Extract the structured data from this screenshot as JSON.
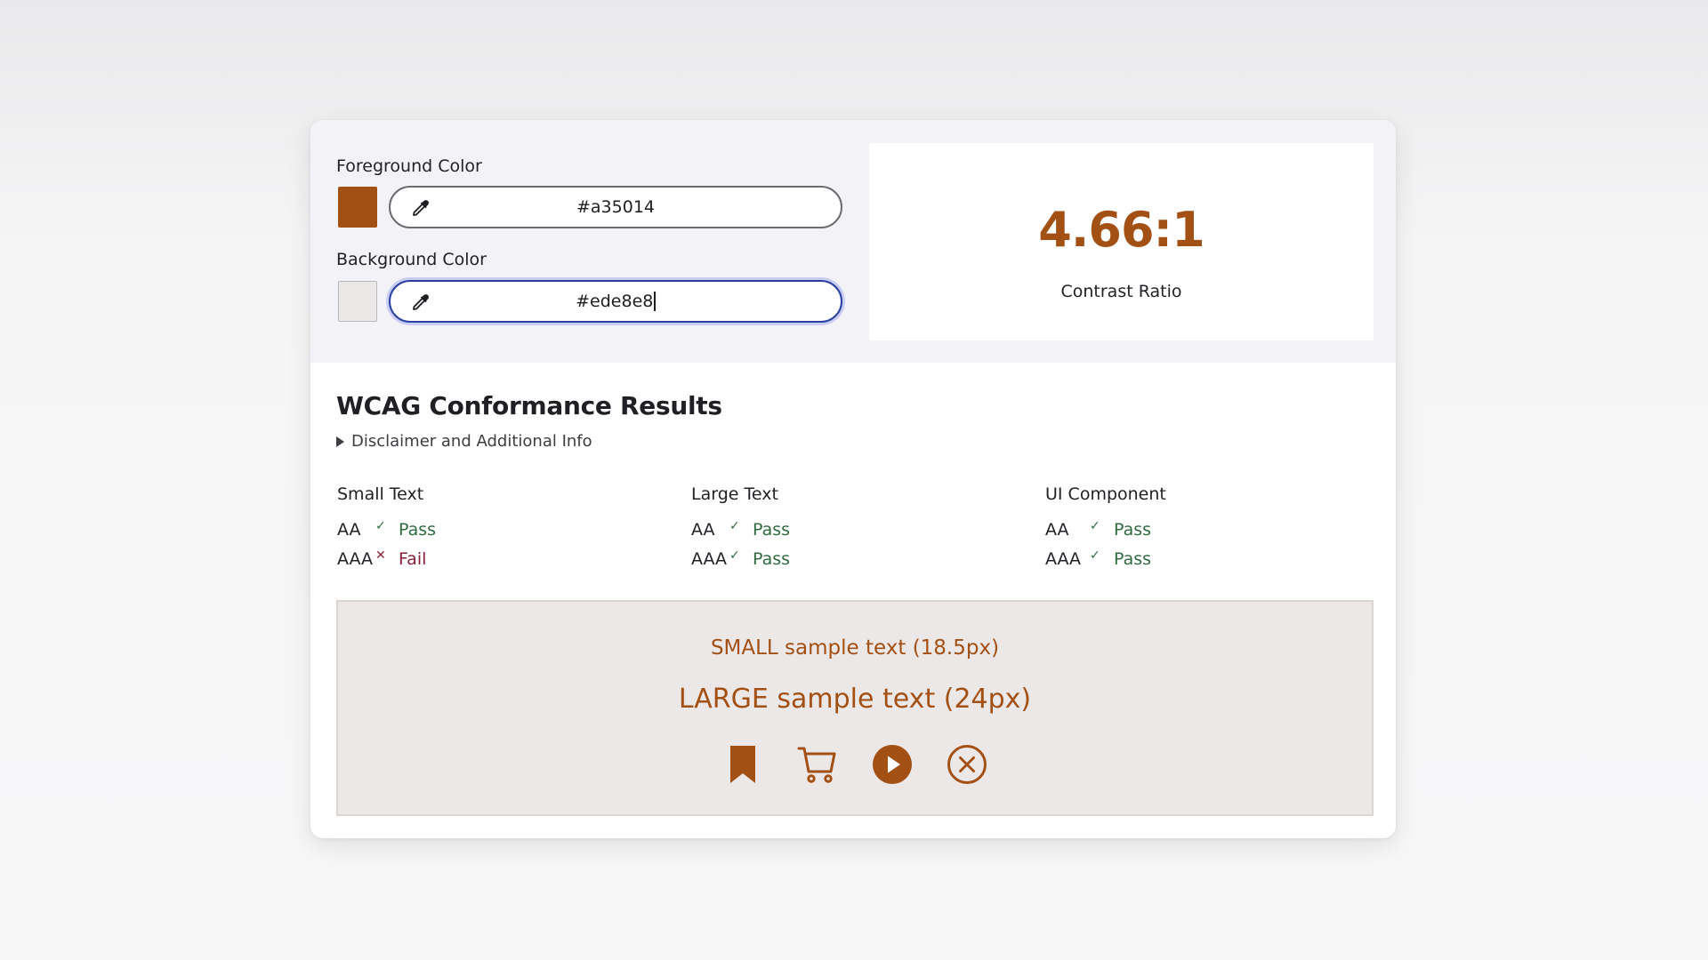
{
  "colors": {
    "foreground": "#a35014",
    "background": "#ede8e8",
    "pass": "#2f6b3f",
    "fail": "#8a1f3a"
  },
  "foreground": {
    "label": "Foreground Color",
    "value": "#a35014",
    "icon": "eyedropper-icon"
  },
  "background": {
    "label": "Background Color",
    "value": "#ede8e8",
    "icon": "eyedropper-icon"
  },
  "ratio": {
    "value": "4.66:1",
    "caption": "Contrast Ratio"
  },
  "results": {
    "title": "WCAG Conformance Results",
    "disclaimer": "Disclaimer and Additional Info",
    "columns": [
      {
        "heading": "Small Text",
        "rows": [
          {
            "level": "AA",
            "icon": "check-icon",
            "result": "Pass"
          },
          {
            "level": "AAA",
            "icon": "cross-icon",
            "result": "Fail"
          }
        ]
      },
      {
        "heading": "Large Text",
        "rows": [
          {
            "level": "AA",
            "icon": "check-icon",
            "result": "Pass"
          },
          {
            "level": "AAA",
            "icon": "check-icon",
            "result": "Pass"
          }
        ]
      },
      {
        "heading": "UI Component",
        "rows": [
          {
            "level": "AA",
            "icon": "check-icon",
            "result": "Pass"
          },
          {
            "level": "AAA",
            "icon": "check-icon",
            "result": "Pass"
          }
        ]
      }
    ]
  },
  "sample": {
    "small_text": "SMALL sample text (18.5px)",
    "large_text": "LARGE sample text (24px)",
    "icons": [
      "bookmark-icon",
      "cart-icon",
      "play-circle-icon",
      "close-circle-icon"
    ]
  }
}
